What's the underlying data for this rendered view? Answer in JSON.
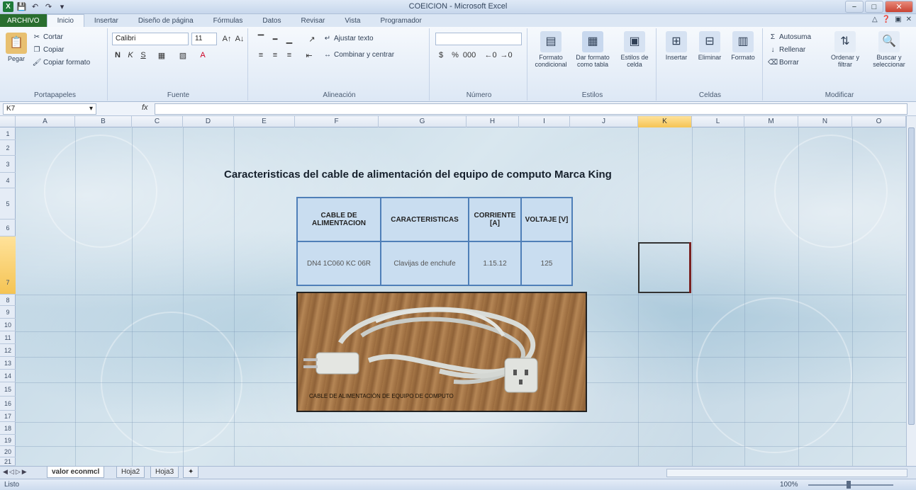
{
  "window": {
    "title": "COEICION - Microsoft Excel"
  },
  "ribbon_tabs": {
    "file": "ARCHIVO",
    "tabs": [
      "Inicio",
      "Insertar",
      "Diseño de página",
      "Fórmulas",
      "Datos",
      "Revisar",
      "Vista",
      "Programador"
    ]
  },
  "ribbon": {
    "clipboard": {
      "paste": "Pegar",
      "cut": "Cortar",
      "copy": "Copiar",
      "format_painter": "Copiar formato",
      "label": "Portapapeles"
    },
    "font": {
      "font_name": "Calibri",
      "font_size": "11",
      "label": "Fuente"
    },
    "alignment": {
      "wrap": "Ajustar texto",
      "merge": "Combinar y centrar",
      "label": "Alineación"
    },
    "number": {
      "label": "Número"
    },
    "styles": {
      "conditional": "Formato condicional",
      "table": "Dar formato como tabla",
      "cell_styles": "Estilos de celda",
      "label": "Estilos"
    },
    "cells": {
      "insert": "Insertar",
      "delete": "Eliminar",
      "format": "Formato",
      "label": "Celdas"
    },
    "editing": {
      "autosum": "Autosuma",
      "fill": "Rellenar",
      "clear": "Borrar",
      "sort": "Ordenar y filtrar",
      "find": "Buscar y seleccionar",
      "label": "Modificar"
    }
  },
  "formula_bar": {
    "name_box": "K7",
    "fx": "fx",
    "value": ""
  },
  "columns": [
    "A",
    "B",
    "C",
    "D",
    "E",
    "F",
    "G",
    "H",
    "I",
    "J",
    "K",
    "L",
    "M",
    "N",
    "O"
  ],
  "rows": [
    "1",
    "2",
    "3",
    "4",
    "5",
    "6",
    "7",
    "8",
    "9",
    "10",
    "11",
    "12",
    "13",
    "14",
    "15",
    "16",
    "17",
    "18",
    "19",
    "20",
    "21"
  ],
  "sheet": {
    "title": "Caracteristicas del cable de alimentación del equipo de computo Marca King",
    "table": {
      "headers": [
        "CABLE DE ALIMENTACION",
        "CARACTERISTICAS",
        "CORRIENTE [A]",
        "VOLTAJE [V]"
      ],
      "row": [
        "DN4 1C060 KC 06R",
        "Clavijas de enchufe",
        "1.15.12",
        "125"
      ]
    },
    "photo_caption": "CABLE DE ALIMENTACIÓN DE EQUIPO DE COMPUTO"
  },
  "sheet_tabs": [
    "valor econmcl",
    "Hoja2",
    "Hoja3"
  ],
  "status": {
    "ready": "Listo",
    "zoom": "100%"
  },
  "colors": {
    "selected_header": "#f5c454",
    "table_border": "#4f7fb8",
    "file_tab": "#2a6e2f"
  }
}
